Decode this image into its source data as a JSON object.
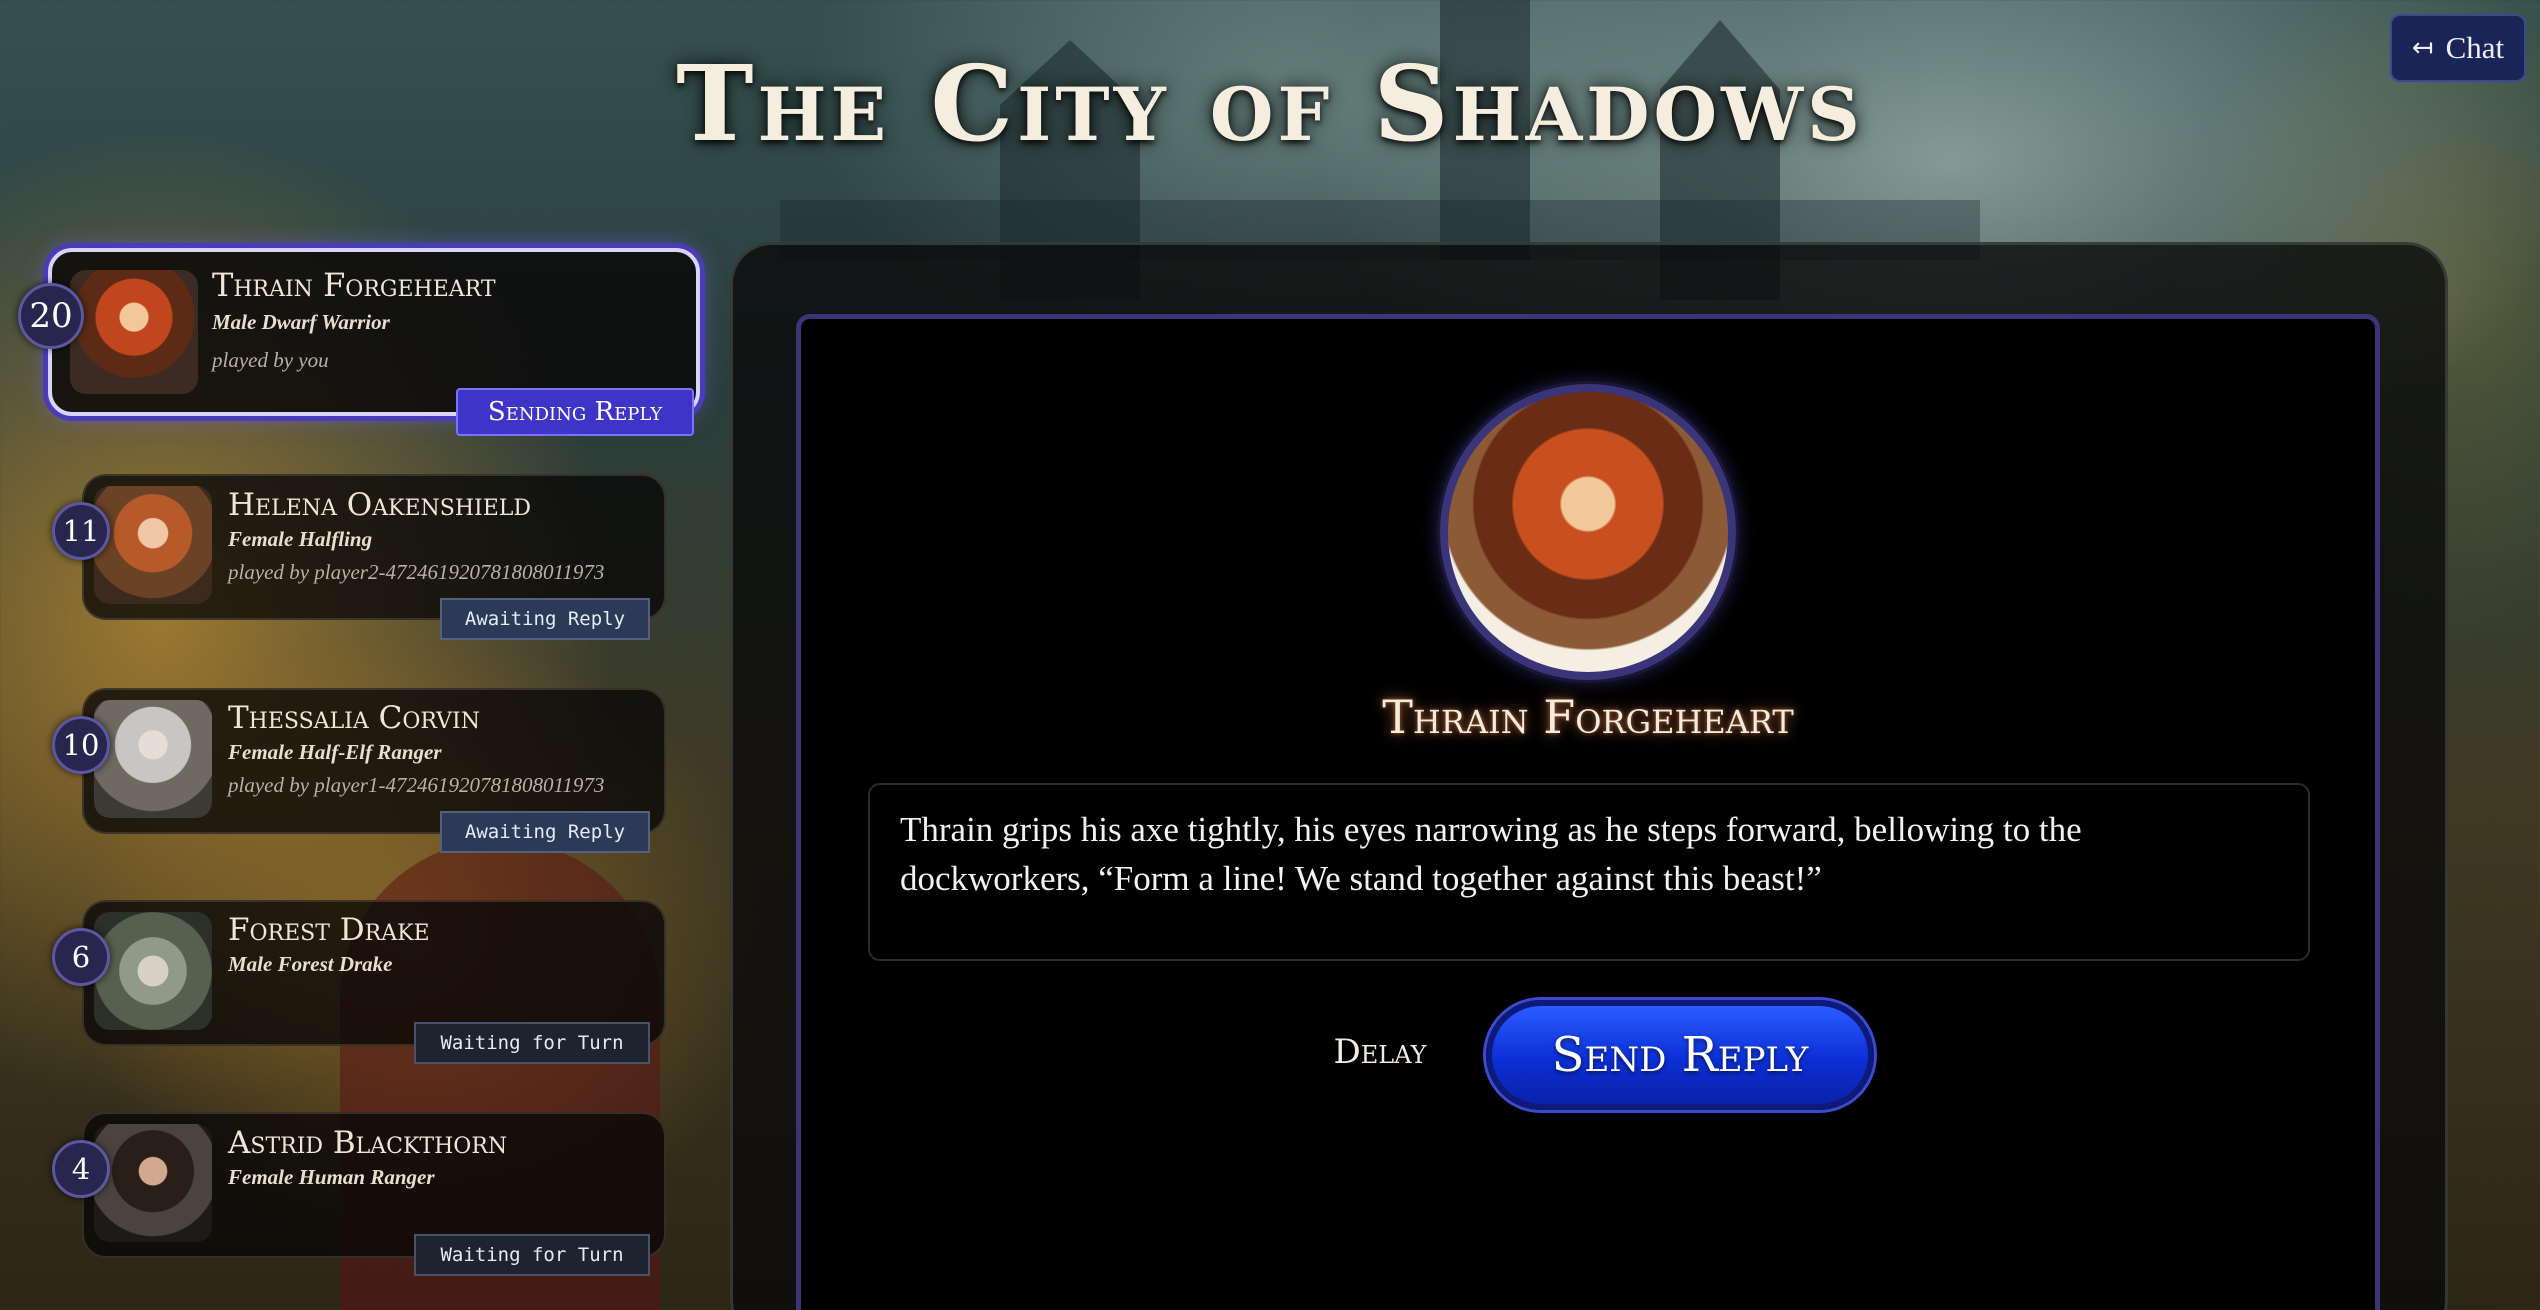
{
  "header": {
    "title": "The City of Shadows",
    "chat_label": "Chat",
    "chat_icon": "exit-arrow-icon"
  },
  "turn_order": [
    {
      "initiative": "20",
      "name": "Thrain Forgeheart",
      "description": "Male Dwarf Warrior",
      "player": "played by you",
      "status": "Sending Reply",
      "active": true
    },
    {
      "initiative": "11",
      "name": "Helena Oakenshield",
      "description": "Female Halfling",
      "player": "played by player2-472461920781808011973",
      "status": "Awaiting Reply",
      "active": false
    },
    {
      "initiative": "10",
      "name": "Thessalia Corvin",
      "description": "Female Half-Elf Ranger",
      "player": "played by player1-472461920781808011973",
      "status": "Awaiting Reply",
      "active": false
    },
    {
      "initiative": "6",
      "name": "Forest Drake",
      "description": "Male Forest Drake",
      "player": "",
      "status": "Waiting for Turn",
      "active": false
    },
    {
      "initiative": "4",
      "name": "Astrid Blackthorn",
      "description": "Female Human Ranger",
      "player": "",
      "status": "Waiting for Turn",
      "active": false
    }
  ],
  "main": {
    "speaker_name": "Thrain Forgeheart",
    "reply_text": "Thrain grips his axe tightly, his eyes narrowing as he steps forward, bellowing to the dockworkers, “Form a line! We stand together against this beast!”",
    "delay_label": "Delay",
    "send_label": "Send Reply"
  },
  "colors": {
    "accent": "#3f34c8",
    "send_button": "#0b2fd6",
    "panel_border": "#3d3478"
  }
}
